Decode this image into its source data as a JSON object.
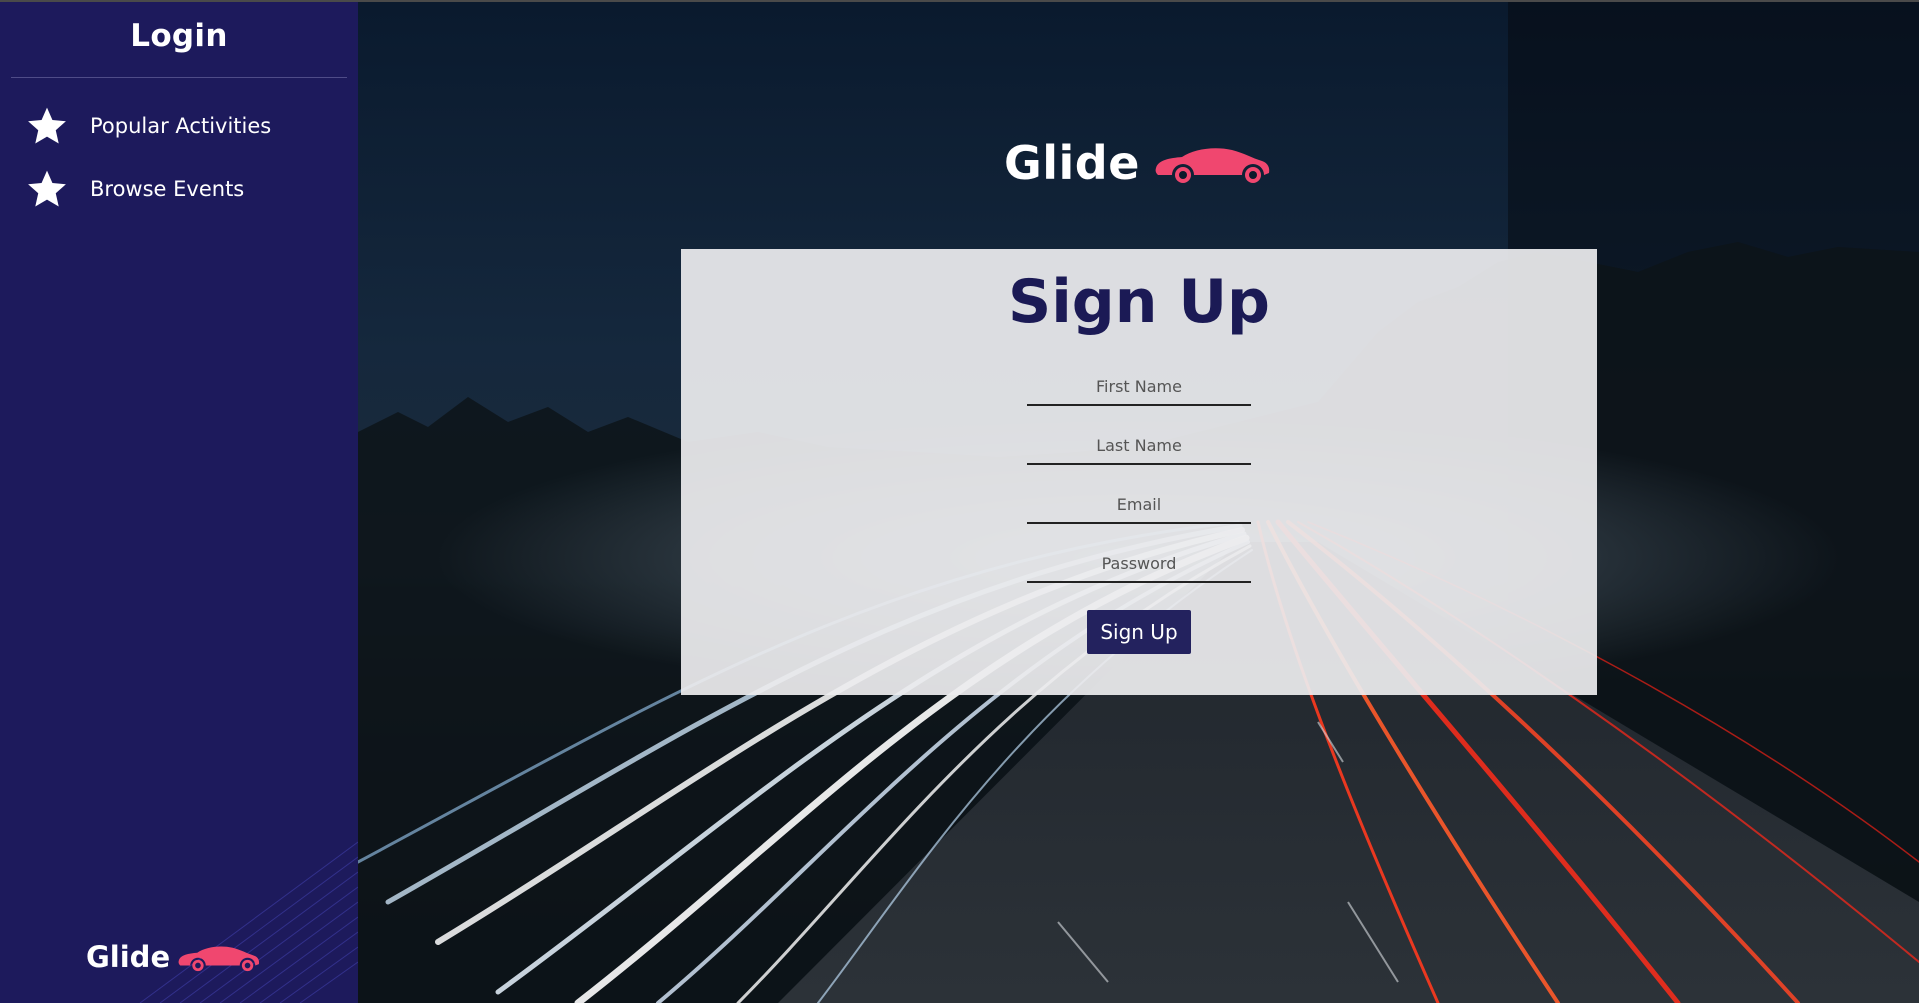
{
  "sidebar": {
    "title": "Login",
    "items": [
      {
        "label": "Popular Activities",
        "icon": "star-icon"
      },
      {
        "label": "Browse Events",
        "icon": "star-icon"
      }
    ],
    "logo": {
      "text": "Glide",
      "icon": "car-icon"
    }
  },
  "header": {
    "brand": "Glide",
    "brand_icon": "car-icon"
  },
  "signup": {
    "title": "Sign Up",
    "fields": [
      {
        "placeholder": "First Name",
        "value": ""
      },
      {
        "placeholder": "Last Name",
        "value": ""
      },
      {
        "placeholder": "Email",
        "value": ""
      },
      {
        "placeholder": "Password",
        "value": ""
      }
    ],
    "submit_label": "Sign Up"
  },
  "colors": {
    "sidebar_bg": "#1d1a5c",
    "accent_car": "#f0476f",
    "title_text": "#1b1a55",
    "button_bg": "#23225e"
  }
}
